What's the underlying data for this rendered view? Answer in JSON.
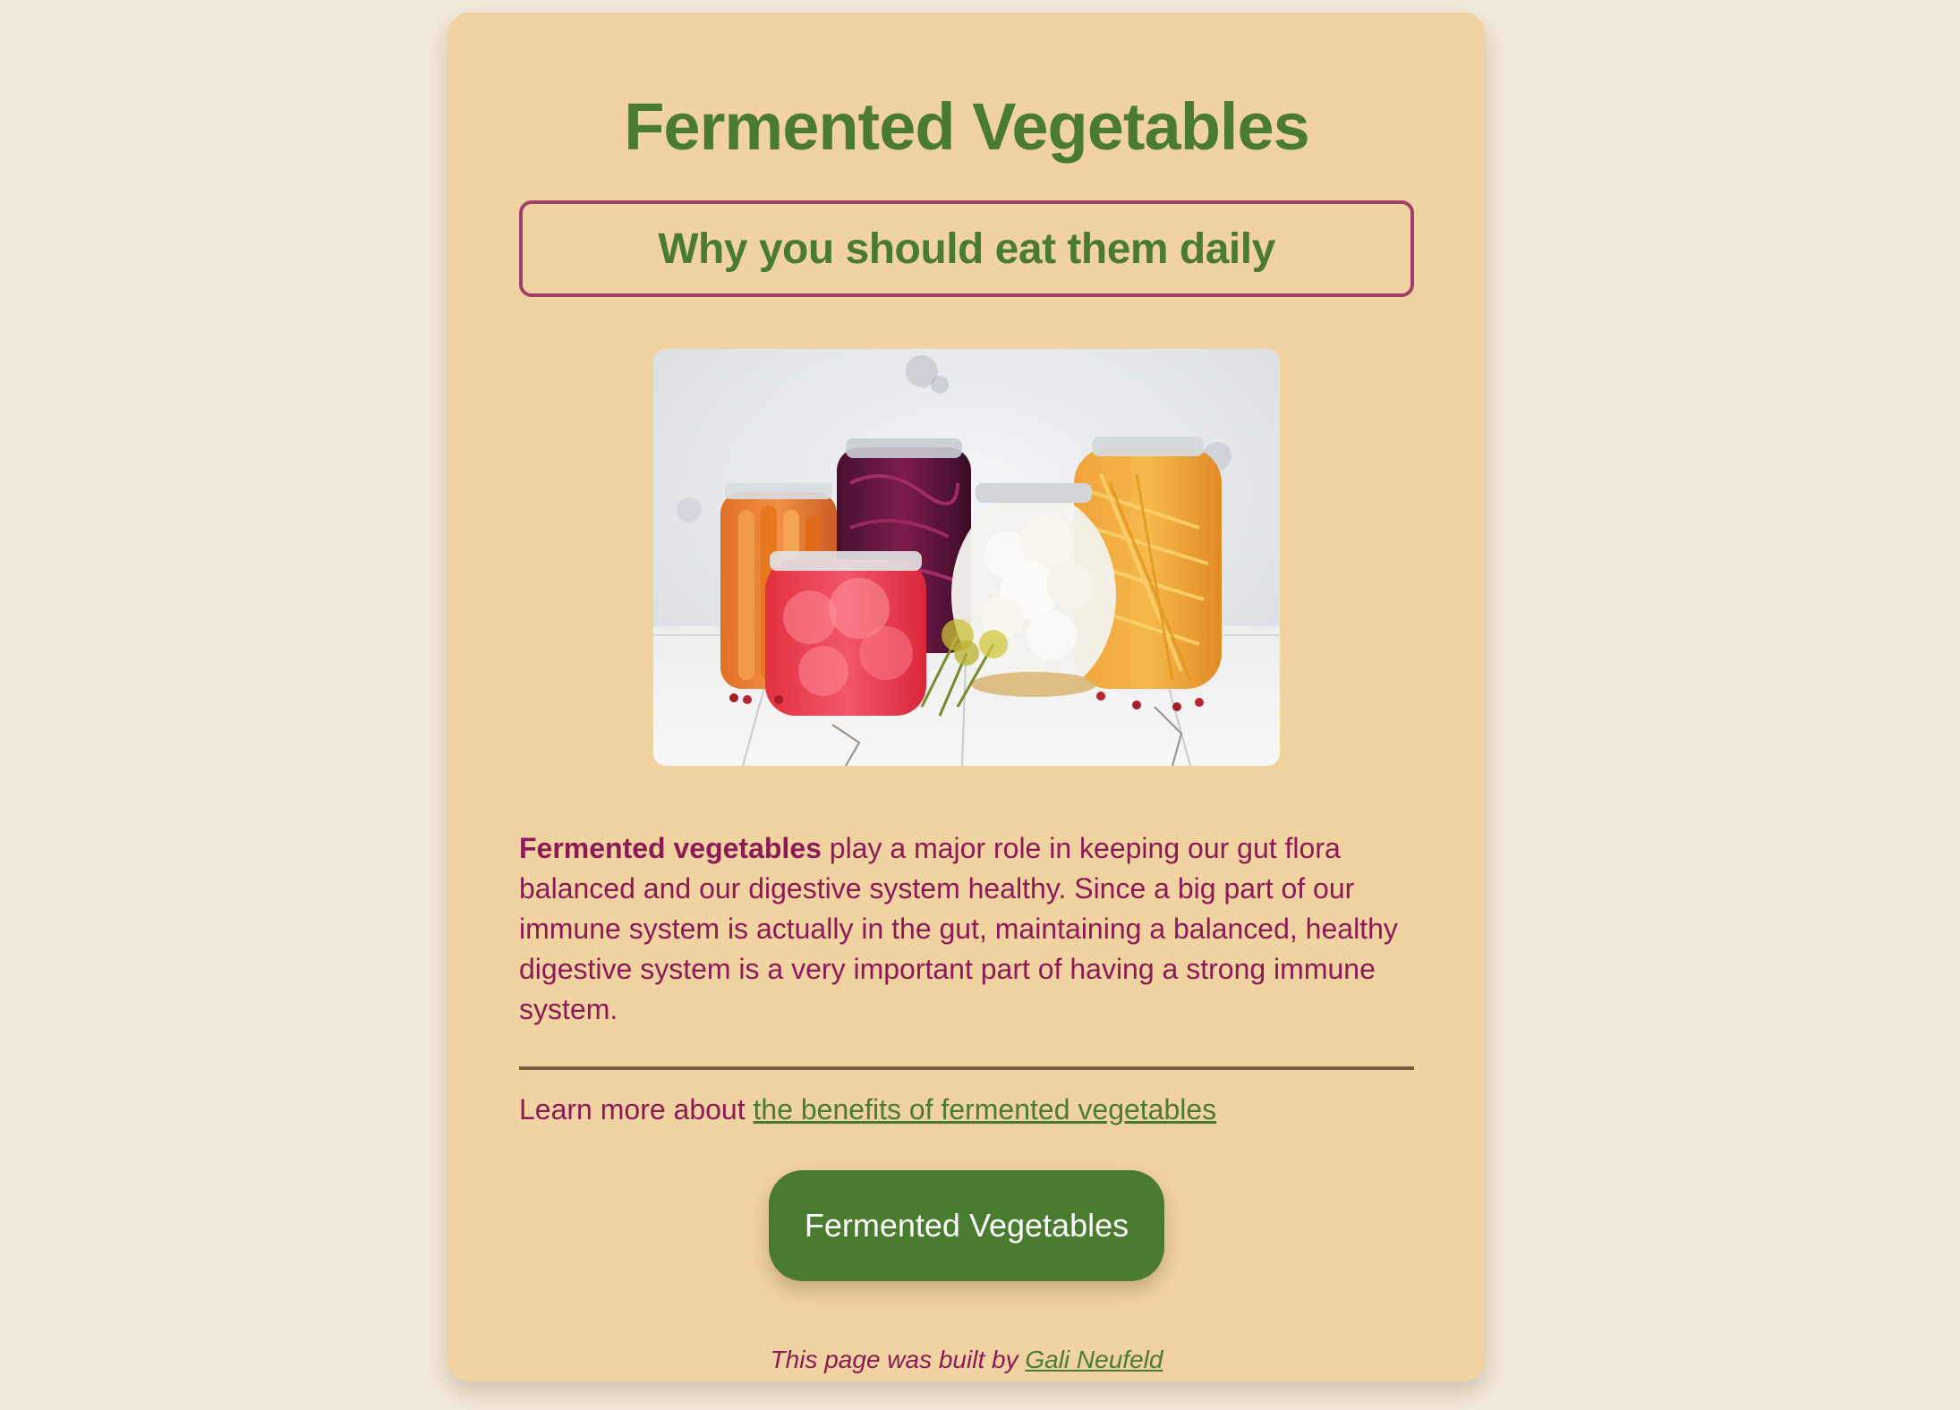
{
  "page": {
    "title": "Fermented Vegetables",
    "subtitle": "Why you should eat them daily"
  },
  "hero_image": {
    "alt": "Jars of fermented vegetables",
    "icon": "fermented-jars-photo"
  },
  "article": {
    "bold_lead": "Fermented vegetables",
    "body": " play a major role in keeping our gut flora balanced and our digestive system healthy. Since a big part of our immune system is actually in the gut, maintaining a balanced, healthy digestive system is a very important part of having a strong immune system."
  },
  "learn_more": {
    "prefix": "Learn more about ",
    "link_text": "the benefits of fermented vegetables"
  },
  "cta": {
    "label": "Fermented Vegetables"
  },
  "footer": {
    "prefix": "This page was built by ",
    "author_link": "Gali Neufeld"
  },
  "colors": {
    "background": "#f2eadb",
    "card": "#f1d2a1",
    "green": "#4a7c30",
    "magenta": "#8b1a56",
    "border": "#a0406a"
  }
}
